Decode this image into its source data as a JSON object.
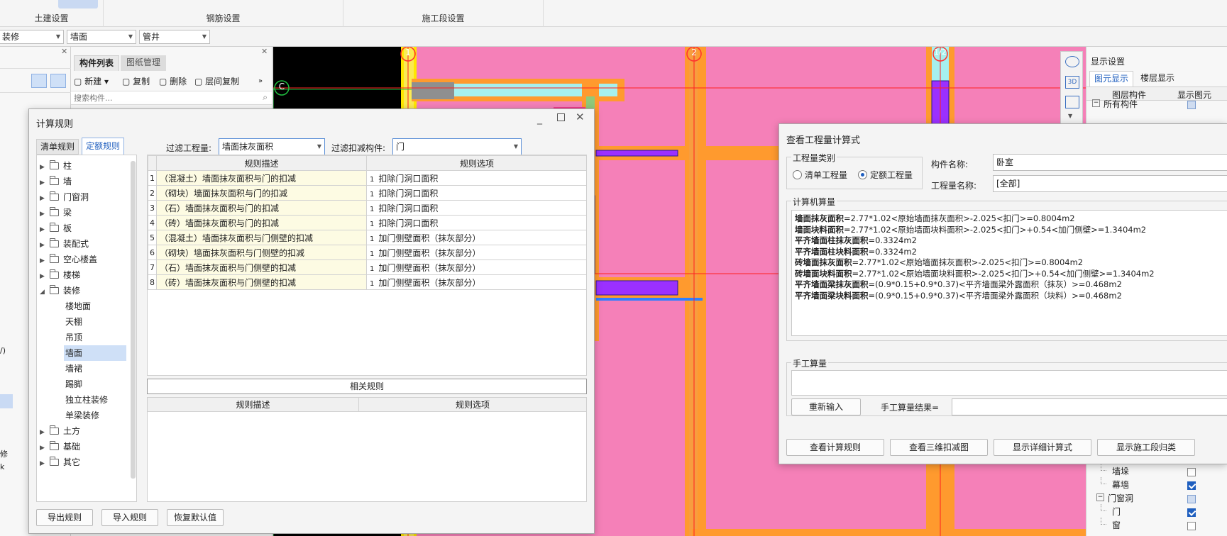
{
  "ribbon": {
    "groups": [
      "土建设置",
      "钢筋设置",
      "施工段设置"
    ]
  },
  "filterbar": {
    "combo1": "装修",
    "combo2": "墙面",
    "combo3": "管井"
  },
  "left_panel": {
    "side_texts": [
      "/)",
      "修",
      "k"
    ]
  },
  "component_panel": {
    "tabs": [
      "构件列表",
      "图纸管理"
    ],
    "toolbar": [
      "新建",
      "复制",
      "删除",
      "层间复制"
    ],
    "search_placeholder": "搜索构件..."
  },
  "canvas": {
    "axis_labels": [
      "1",
      "2",
      "1/2",
      "C"
    ]
  },
  "rules_dialog": {
    "title": "计算规则",
    "tabs": [
      "清单规则",
      "定额规则"
    ],
    "filter_qty_label": "过滤工程量:",
    "filter_qty_value": "墙面抹灰面积",
    "filter_deduct_label": "过滤扣减构件:",
    "filter_deduct_value": "门",
    "tree": [
      {
        "label": "柱",
        "expanded": false
      },
      {
        "label": "墙",
        "expanded": false
      },
      {
        "label": "门窗洞",
        "expanded": false
      },
      {
        "label": "梁",
        "expanded": false
      },
      {
        "label": "板",
        "expanded": false
      },
      {
        "label": "装配式",
        "expanded": false
      },
      {
        "label": "空心楼盖",
        "expanded": false
      },
      {
        "label": "楼梯",
        "expanded": false
      },
      {
        "label": "装修",
        "expanded": true
      }
    ],
    "tree_children": [
      "楼地面",
      "天棚",
      "吊顶",
      "墙面",
      "墙裙",
      "踢脚",
      "独立柱装修",
      "单梁装修"
    ],
    "tree_tail": [
      "土方",
      "基础",
      "其它"
    ],
    "selected_child": "墙面",
    "columns": [
      "规则描述",
      "规则选项"
    ],
    "rows": [
      {
        "num": "1",
        "desc": "（混凝土）墙面抹灰面积与门的扣减",
        "opt_num": "1",
        "opt": "扣除门洞口面积"
      },
      {
        "num": "2",
        "desc": "（砌块）墙面抹灰面积与门的扣减",
        "opt_num": "1",
        "opt": "扣除门洞口面积"
      },
      {
        "num": "3",
        "desc": "（石）墙面抹灰面积与门的扣减",
        "opt_num": "1",
        "opt": "扣除门洞口面积"
      },
      {
        "num": "4",
        "desc": "（砖）墙面抹灰面积与门的扣减",
        "opt_num": "1",
        "opt": "扣除门洞口面积"
      },
      {
        "num": "5",
        "desc": "（混凝土）墙面抹灰面积与门侧壁的扣减",
        "opt_num": "1",
        "opt": "加门侧壁面积（抹灰部分）"
      },
      {
        "num": "6",
        "desc": "（砌块）墙面抹灰面积与门侧壁的扣减",
        "opt_num": "1",
        "opt": "加门侧壁面积（抹灰部分）"
      },
      {
        "num": "7",
        "desc": "（石）墙面抹灰面积与门侧壁的扣减",
        "opt_num": "1",
        "opt": "加门侧壁面积（抹灰部分）"
      },
      {
        "num": "8",
        "desc": "（砖）墙面抹灰面积与门侧壁的扣减",
        "opt_num": "1",
        "opt": "加门侧壁面积（抹灰部分）"
      }
    ],
    "related_rules": "相关规则",
    "buttons": [
      "导出规则",
      "导入规则",
      "恢复默认值"
    ]
  },
  "calc_dialog": {
    "title": "查看工程量计算式",
    "qty_type_label": "工程量类别",
    "radio_list": "清单工程量",
    "radio_quota": "定额工程量",
    "comp_name_label": "构件名称:",
    "comp_name_value": "卧室",
    "qty_name_label": "工程量名称:",
    "qty_name_value": "[全部]",
    "computer_label": "计算机算量",
    "lines": [
      {
        "name": "墙面抹灰面积",
        "expr": "=2.77*1.02<原始墙面抹灰面积>-2.025<扣门>=0.8004m2"
      },
      {
        "name": "墙面块料面积",
        "expr": "=2.77*1.02<原始墙面块料面积>-2.025<扣门>+0.54<加门侧壁>=1.3404m2"
      },
      {
        "name": "平齐墙面柱抹灰面积",
        "expr": "=0.3324m2"
      },
      {
        "name": "平齐墙面柱块料面积",
        "expr": "=0.3324m2"
      },
      {
        "name": "砖墙面抹灰面积",
        "expr": "=2.77*1.02<原始墙面抹灰面积>-2.025<扣门>=0.8004m2"
      },
      {
        "name": "砖墙面块料面积",
        "expr": "=2.77*1.02<原始墙面块料面积>-2.025<扣门>+0.54<加门侧壁>=1.3404m2"
      },
      {
        "name": "平齐墙面梁抹灰面积",
        "expr": "=(0.9*0.15+0.9*0.37)<平齐墙面梁外露面积（抹灰）>=0.468m2"
      },
      {
        "name": "平齐墙面梁块料面积",
        "expr": "=(0.9*0.15+0.9*0.37)<平齐墙面梁外露面积（块料）>=0.468m2"
      }
    ],
    "manual_label": "手工算量",
    "reenter": "重新输入",
    "manual_result_label": "手工算量结果=",
    "buttons": [
      "查看计算规则",
      "查看三维扣减图",
      "显示详细计算式",
      "显示施工段归类"
    ]
  },
  "display_panel": {
    "title": "显示设置",
    "tabs": [
      "图元显示",
      "楼层显示"
    ],
    "columns": [
      "图层构件",
      "显示图元"
    ],
    "top_rows": [
      {
        "label": "所有构件",
        "check": "part"
      }
    ],
    "bottom_rows": [
      {
        "label": "墙垛",
        "check": "off",
        "indent": 1
      },
      {
        "label": "幕墙",
        "check": "on",
        "indent": 1
      },
      {
        "label": "门窗洞",
        "check": "part",
        "indent": 0
      },
      {
        "label": "门",
        "check": "on",
        "indent": 1
      },
      {
        "label": "窗",
        "check": "off",
        "indent": 1
      }
    ]
  }
}
